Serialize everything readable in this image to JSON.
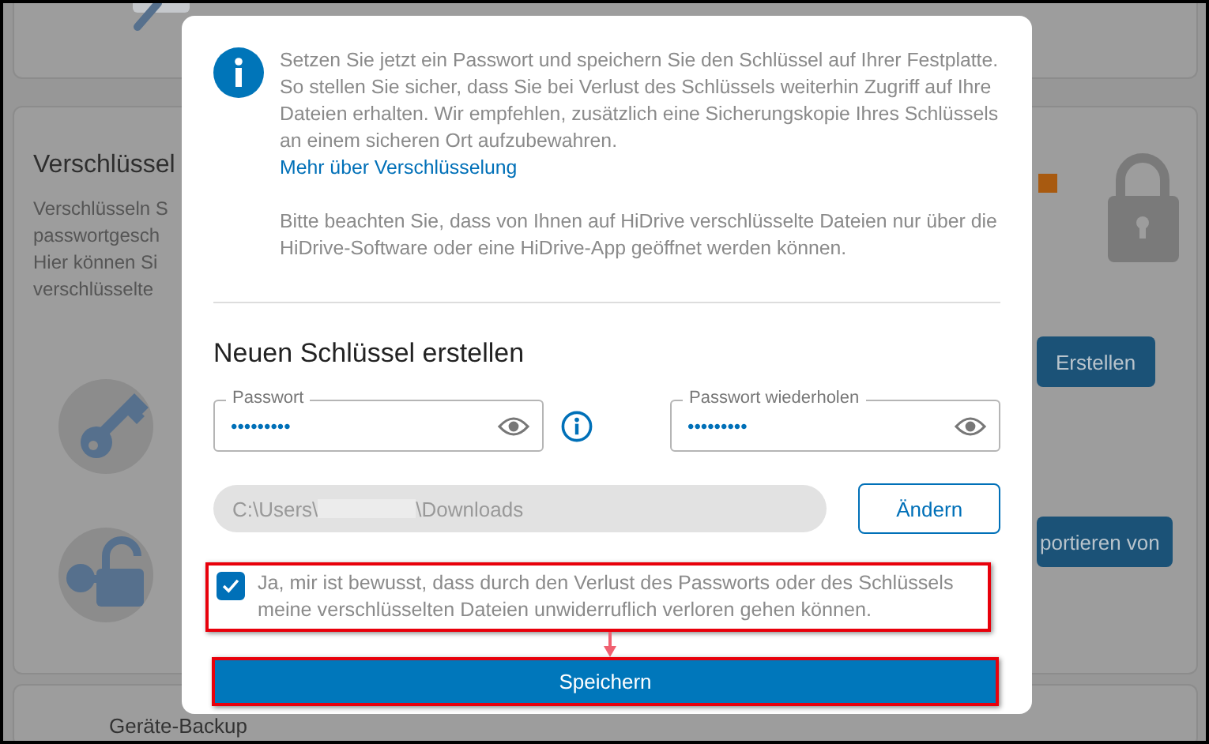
{
  "background": {
    "section_title": "Verschlüssel",
    "description_lines": [
      "Verschlüsseln S",
      "passwortgesch",
      "Hier können Si",
      "verschlüsselte"
    ],
    "buttons": [
      "Erstellen",
      "portieren von"
    ],
    "next_section_title": "Geräte-Backup"
  },
  "dialog": {
    "info_text": "Setzen Sie jetzt ein Passwort und speichern Sie den Schlüssel auf Ihrer Festplatte. So stellen Sie sicher, dass Sie bei Verlust des Schlüssels weiterhin Zugriff auf Ihre Dateien erhalten. Wir empfehlen, zusätzlich eine Sicherungskopie Ihres Schlüssels an einem sicheren Ort aufzubewahren.",
    "info_link": "Mehr über Verschlüsselung",
    "note_text": "Bitte beachten Sie, dass von Ihnen auf HiDrive verschlüsselte Dateien nur über die HiDrive-Software oder eine HiDrive-App geöffnet werden können.",
    "heading": "Neuen Schlüssel erstellen",
    "fields": [
      {
        "label": "Passwort",
        "value": "•••••••••",
        "has_info": true
      },
      {
        "label": "Passwort wiederholen",
        "value": "•••••••••",
        "has_info": false
      }
    ],
    "path": {
      "prefix": "C:\\Users\\",
      "suffix": "\\Downloads",
      "redacted": true
    },
    "change_button": "Ändern",
    "consent": {
      "text": "Ja, mir ist bewusst, dass durch den Verlust des Passworts oder des Schlüssels meine verschlüsselten Dateien unwiderruflich verloren gehen können.",
      "checked": true,
      "highlighted": true
    },
    "save_button": {
      "label": "Speichern",
      "highlighted": true
    }
  }
}
